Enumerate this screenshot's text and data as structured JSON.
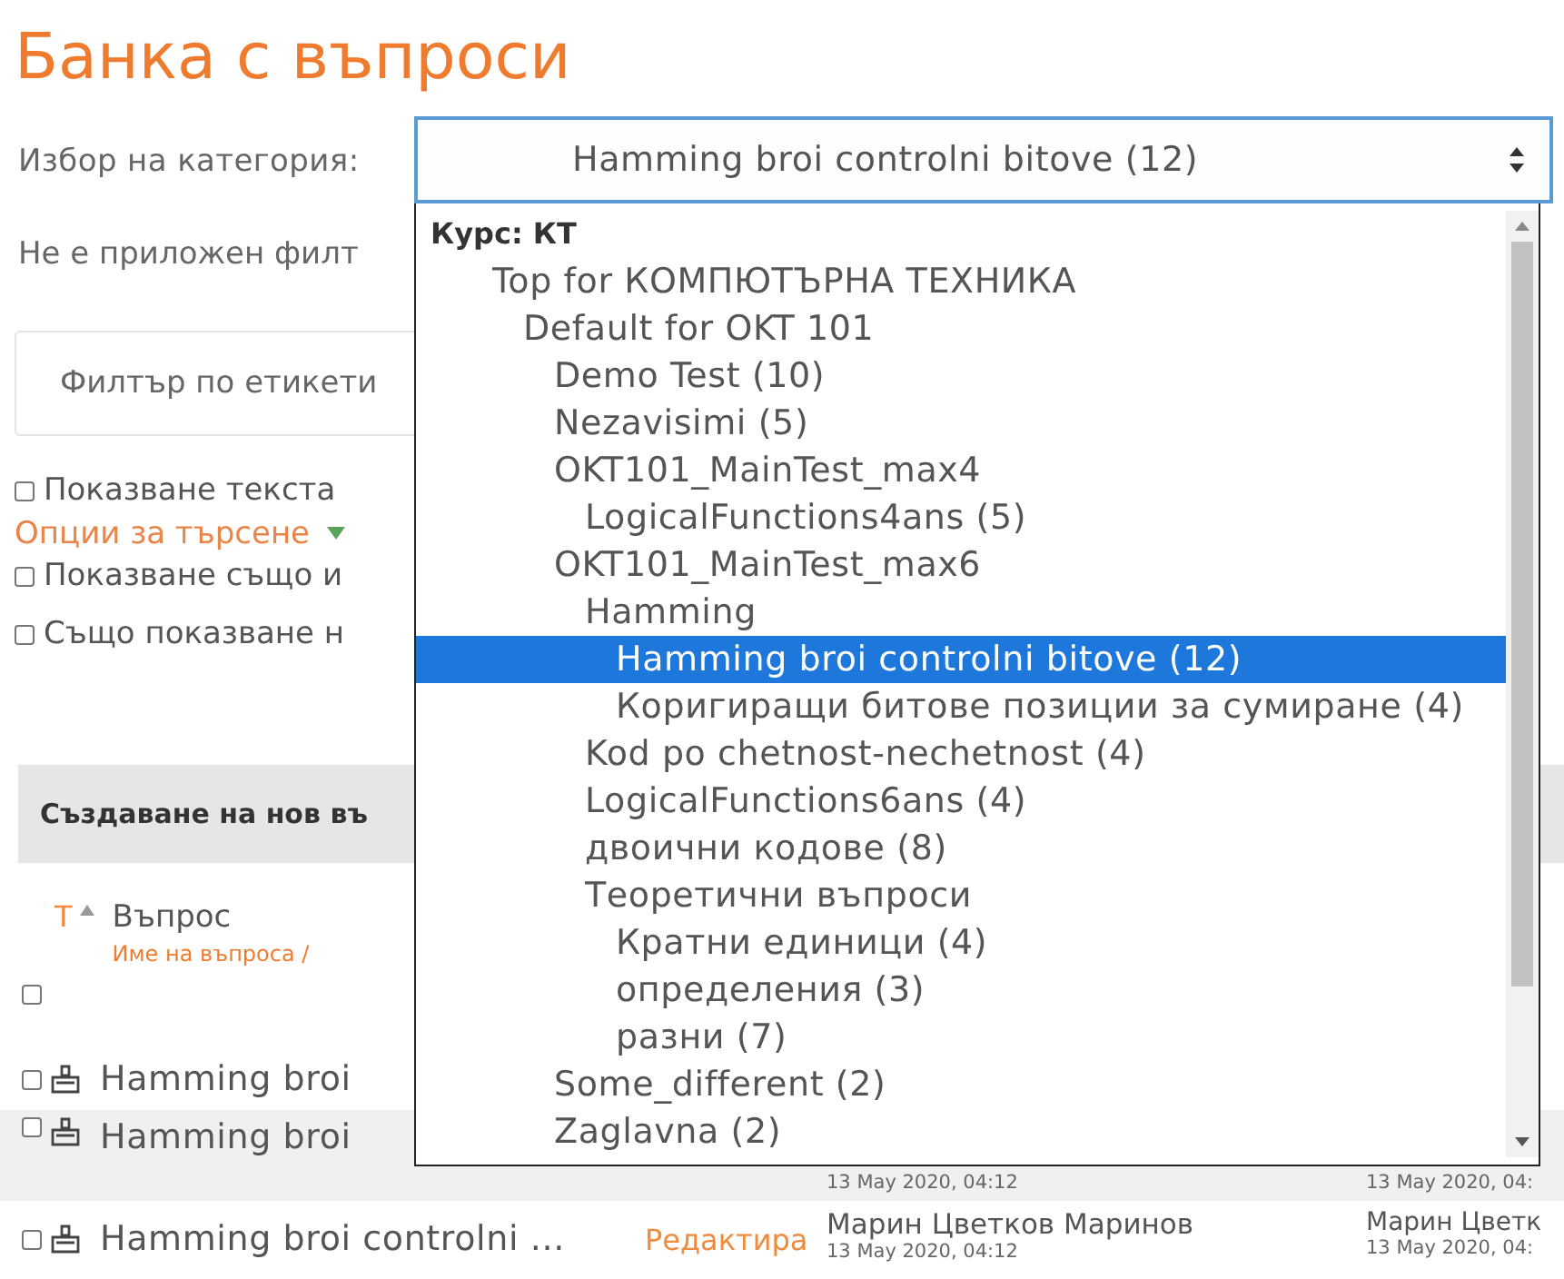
{
  "title": "Банка с въпроси",
  "category": {
    "label": "Избор на категория:",
    "value": "Hamming broi controlni bitove (12)"
  },
  "filter_status": "Не е приложен филт",
  "tag_filter": {
    "placeholder": "Филтър по етикети"
  },
  "options": [
    {
      "kind": "checkbox",
      "label": "Показване текста",
      "checked": false
    },
    {
      "kind": "link",
      "label": "Опции за търсене"
    },
    {
      "kind": "checkbox",
      "label": "Показване също и",
      "checked": false
    },
    {
      "kind": "checkbox",
      "label": "Също показване н",
      "checked": false
    }
  ],
  "create_button": "Създаване на нов въ",
  "table": {
    "sort_label": "Т",
    "column": "Въпрос",
    "subcolumn": "Име на въпроса /",
    "select_all": {
      "checked": false
    },
    "rows": [
      {
        "name": "Hamming broi",
        "checked": false,
        "shaded": false
      },
      {
        "name": "Hamming broi",
        "checked": false,
        "shaded": true,
        "created_date": "13 May 2020, 04:12",
        "modified_date": "13 May 2020, 04:"
      },
      {
        "name": "Hamming broi controlni ...",
        "checked": false,
        "shaded": false,
        "edit": "Редактира",
        "created_by": "Марин Цветков Маринов",
        "created_date": "13 May 2020, 04:12",
        "modified_by": "Марин Цветк",
        "modified_date": "13 May 2020, 04:"
      }
    ]
  },
  "dropdown": {
    "heading": "Курс: КТ",
    "items": [
      {
        "label": "Top for КОМПЮТЪРНА ТЕХНИКА",
        "selected": false,
        "children": [
          {
            "label": "Default for OKT 101",
            "selected": false,
            "children": [
              {
                "label": "Demo Test (10)",
                "selected": false
              },
              {
                "label": "Nezavisimi (5)",
                "selected": false
              },
              {
                "label": "OKT101_MainTest_max4",
                "selected": false,
                "children": [
                  {
                    "label": "LogicalFunctions4ans (5)",
                    "selected": false
                  }
                ]
              },
              {
                "label": "OKT101_MainTest_max6",
                "selected": false,
                "children": [
                  {
                    "label": "Hamming",
                    "selected": false,
                    "children": [
                      {
                        "label": "Hamming broi controlni bitove (12)",
                        "selected": true
                      },
                      {
                        "label": "Коригиращи битове позиции за сумиране (4)",
                        "selected": false
                      }
                    ]
                  },
                  {
                    "label": "Kod po chetnost-nechetnost (4)",
                    "selected": false
                  },
                  {
                    "label": "LogicalFunctions6ans (4)",
                    "selected": false
                  },
                  {
                    "label": "двоични кодове (8)",
                    "selected": false
                  },
                  {
                    "label": "Теоретични въпроси",
                    "selected": false,
                    "children": [
                      {
                        "label": "Кратни единици (4)",
                        "selected": false
                      },
                      {
                        "label": "определения (3)",
                        "selected": false
                      },
                      {
                        "label": "разни (7)",
                        "selected": false
                      }
                    ]
                  }
                ]
              },
              {
                "label": "Some_different (2)",
                "selected": false
              },
              {
                "label": "Zaglavna (2)",
                "selected": false
              }
            ]
          }
        ]
      }
    ]
  }
}
